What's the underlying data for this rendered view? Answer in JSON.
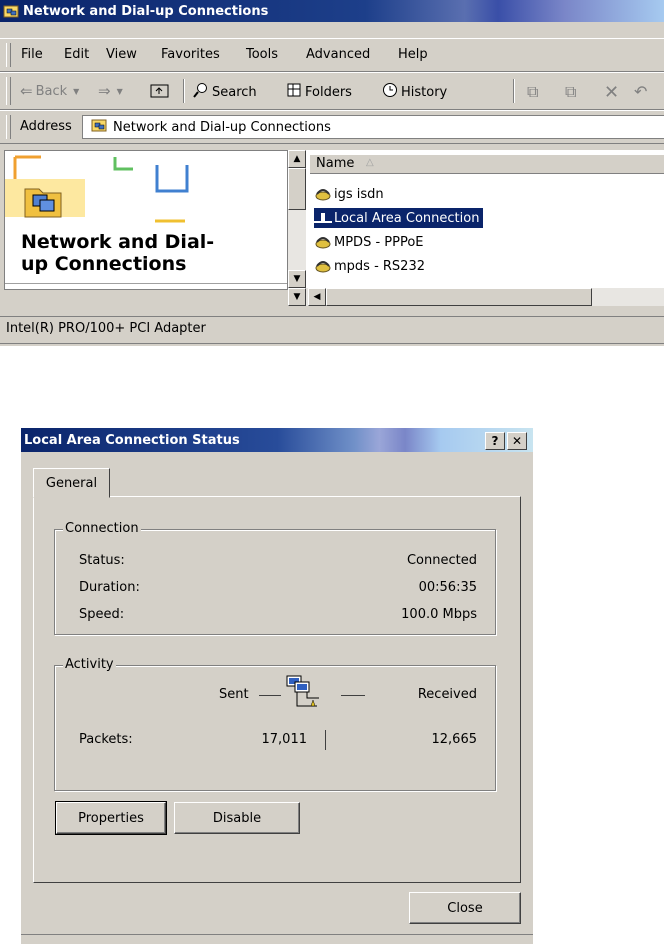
{
  "explorer": {
    "title": "Network and Dial-up Connections",
    "menu": [
      "File",
      "Edit",
      "View",
      "Favorites",
      "Tools",
      "Advanced",
      "Help"
    ],
    "toolbar": {
      "back": "Back",
      "search": "Search",
      "folders": "Folders",
      "history": "History"
    },
    "address": {
      "label": "Address",
      "value": "Network and Dial-up Connections"
    },
    "left_panel": {
      "title_line1": "Network and Dial-",
      "title_line2": "up Connections"
    },
    "list": {
      "column_header": "Name",
      "items": [
        {
          "label": "igs isdn",
          "icon": "dialup-connection-icon",
          "selected": false
        },
        {
          "label": "Local Area Connection",
          "icon": "lan-connection-icon",
          "selected": true
        },
        {
          "label": "MPDS - PPPoE",
          "icon": "dialup-connection-icon",
          "selected": false
        },
        {
          "label": "mpds - RS232",
          "icon": "dialup-connection-icon",
          "selected": false
        }
      ]
    },
    "status_bar": "Intel(R) PRO/100+ PCI Adapter"
  },
  "dialog": {
    "title": "Local Area Connection Status",
    "help_button": "?",
    "close_x": "✕",
    "tab": "General",
    "connection": {
      "group_label": "Connection",
      "status_label": "Status:",
      "status_value": "Connected",
      "duration_label": "Duration:",
      "duration_value": "00:56:35",
      "speed_label": "Speed:",
      "speed_value": "100.0 Mbps"
    },
    "activity": {
      "group_label": "Activity",
      "sent_label": "Sent",
      "received_label": "Received",
      "packets_label": "Packets:",
      "packets_sent": "17,011",
      "packets_received": "12,665"
    },
    "buttons": {
      "properties": "Properties",
      "disable": "Disable",
      "close": "Close"
    }
  },
  "colors": {
    "title_active": "#0a246a",
    "face": "#d4d0c8",
    "selection": "#0a246a"
  }
}
